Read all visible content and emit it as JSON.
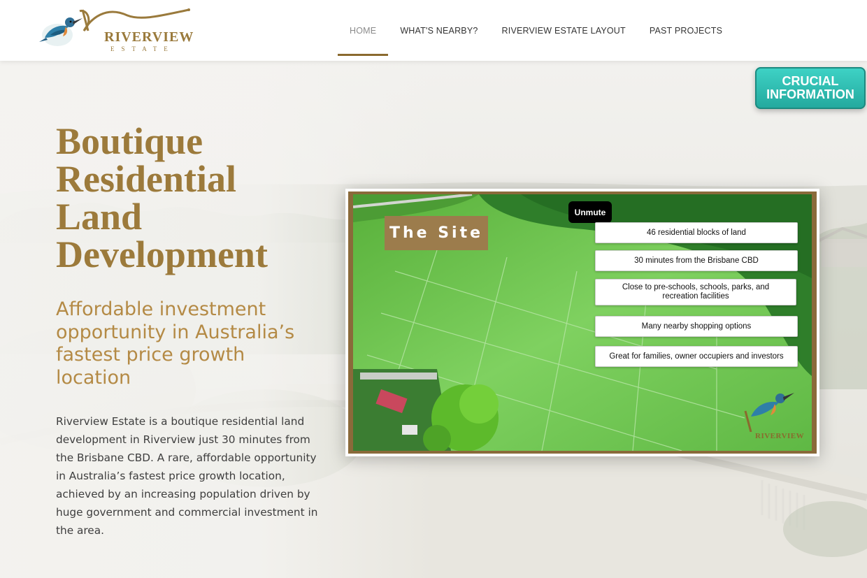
{
  "header": {
    "logo": {
      "wordmark": "RIVERVIEW",
      "sub": "ESTATE"
    },
    "nav": [
      {
        "label": "HOME",
        "active": true
      },
      {
        "label": "WHAT'S NEARBY?"
      },
      {
        "label": "RIVERVIEW ESTATE LAYOUT"
      },
      {
        "label": "PAST PROJECTS"
      }
    ]
  },
  "crucial": {
    "line1": "CRUCIAL",
    "line2": "INFORMATION"
  },
  "hero": {
    "title": [
      "Boutique",
      "Residential",
      "Land",
      "Development"
    ],
    "subtitle": "Affordable investment opportunity in Australia’s fastest price growth location",
    "description": "Riverview Estate is a boutique residential land development in Riverview just 30 minutes from the Brisbane CBD. A rare, affordable opportunity in Australia’s fastest price growth location, achieved by an increasing population driven by huge government and commercial investment in the area."
  },
  "video": {
    "unmute_label": "Unmute",
    "site_label": "The Site",
    "facts": [
      "46 residential blocks of land",
      "30 minutes from the Brisbane CBD",
      "Close to pre-schools, schools, parks, and recreation facilities",
      "Many nearby shopping options",
      "Great for families, owner occupiers and investors"
    ],
    "watermark": "RIVERVIEW"
  },
  "colors": {
    "gold": "#9c7a3b",
    "teal": "#22a89d",
    "grass": "#6cc24a"
  }
}
